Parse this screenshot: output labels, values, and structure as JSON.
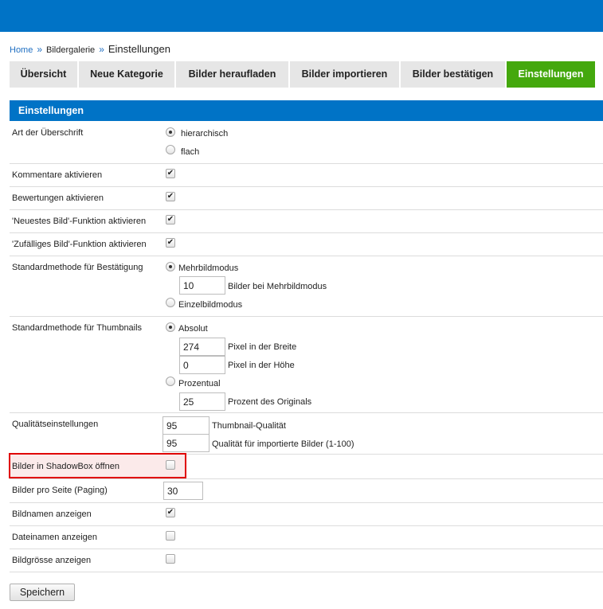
{
  "breadcrumb": {
    "home": "Home",
    "sep": "»",
    "gallery": "Bildergalerie",
    "current": "Einstellungen"
  },
  "tabs": [
    {
      "label": "Übersicht",
      "active": false
    },
    {
      "label": "Neue Kategorie",
      "active": false
    },
    {
      "label": "Bilder heraufladen",
      "active": false
    },
    {
      "label": "Bilder importieren",
      "active": false
    },
    {
      "label": "Bilder bestätigen",
      "active": false
    },
    {
      "label": "Einstellungen",
      "active": true
    }
  ],
  "colors": {
    "header_blue": "#0073c6",
    "active_tab_green": "#44a80d",
    "highlight_red": "#e00000"
  },
  "section_title": "Einstellungen",
  "settings": {
    "heading_type": {
      "label": "Art der Überschrift",
      "options": [
        "hierarchisch",
        "flach"
      ],
      "selected": "hierarchisch"
    },
    "comments": {
      "label": "Kommentare aktivieren",
      "checked": true
    },
    "ratings": {
      "label": "Bewertungen aktivieren",
      "checked": true
    },
    "newest": {
      "label": "'Neuestes Bild'-Funktion aktivieren",
      "checked": true
    },
    "random": {
      "label": "'Zufälliges Bild'-Funktion aktivieren",
      "checked": true
    },
    "confirm_method": {
      "label": "Standardmethode für Bestätigung",
      "option_multi": "Mehrbildmodus",
      "multi_count": "10",
      "multi_count_label": "Bilder bei Mehrbildmodus",
      "option_single": "Einzelbildmodus",
      "selected": "Mehrbildmodus"
    },
    "thumb_method": {
      "label": "Standardmethode für Thumbnails",
      "option_absolute": "Absolut",
      "width": "274",
      "width_label": "Pixel in der Breite",
      "height": "0",
      "height_label": "Pixel in der Höhe",
      "option_percent": "Prozentual",
      "percent": "25",
      "percent_label": "Prozent des Originals",
      "selected": "Absolut"
    },
    "quality": {
      "label": "Qualitätseinstellungen",
      "thumb_quality": "95",
      "thumb_quality_label": "Thumbnail-Qualität",
      "import_quality": "95",
      "import_quality_label": "Qualität für importierte Bilder (1-100)"
    },
    "shadowbox": {
      "label": "Bilder in ShadowBox öffnen",
      "checked": false
    },
    "paging": {
      "label": "Bilder pro Seite (Paging)",
      "value": "30"
    },
    "show_name": {
      "label": "Bildnamen anzeigen",
      "checked": true
    },
    "show_filename": {
      "label": "Dateinamen anzeigen",
      "checked": false
    },
    "show_size": {
      "label": "Bildgrösse anzeigen",
      "checked": false
    }
  },
  "save_label": "Speichern"
}
